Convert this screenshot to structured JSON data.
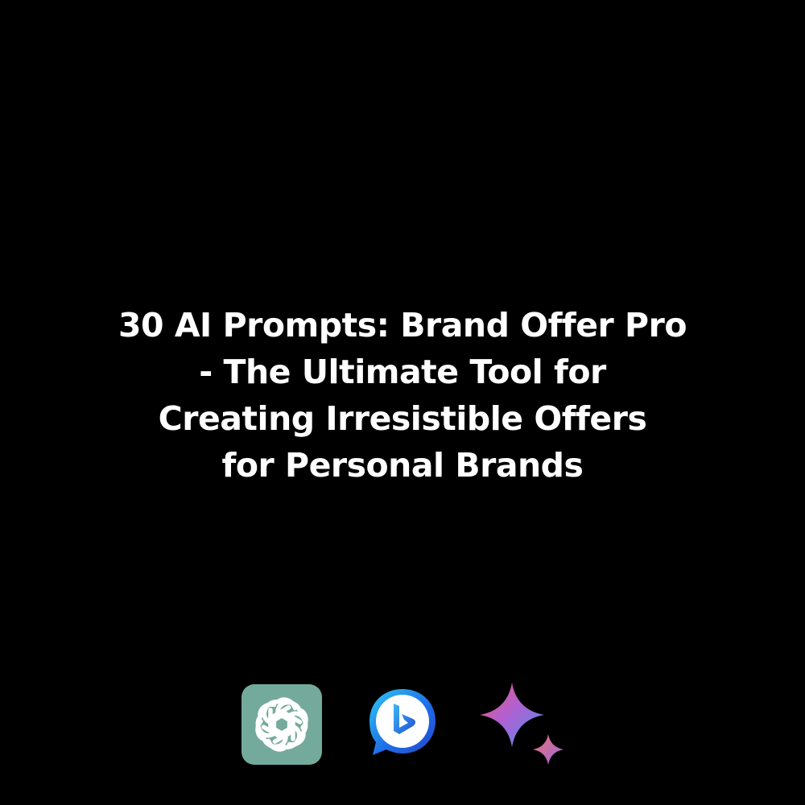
{
  "headline": {
    "lines": [
      "30 AI Prompts: Brand Offer Pro",
      "- The Ultimate Tool for",
      "Creating Irresistible Offers",
      "for Personal Brands"
    ]
  },
  "logos": [
    {
      "icon": "chatgpt-logo-icon",
      "color": "#74aa9c"
    },
    {
      "icon": "bing-chat-logo-icon",
      "color": "#1e7ae6"
    },
    {
      "icon": "gemini-sparkle-logo-icon",
      "color": "#8a7be0"
    }
  ],
  "colors": {
    "background": "#000000",
    "text": "#ffffff"
  }
}
